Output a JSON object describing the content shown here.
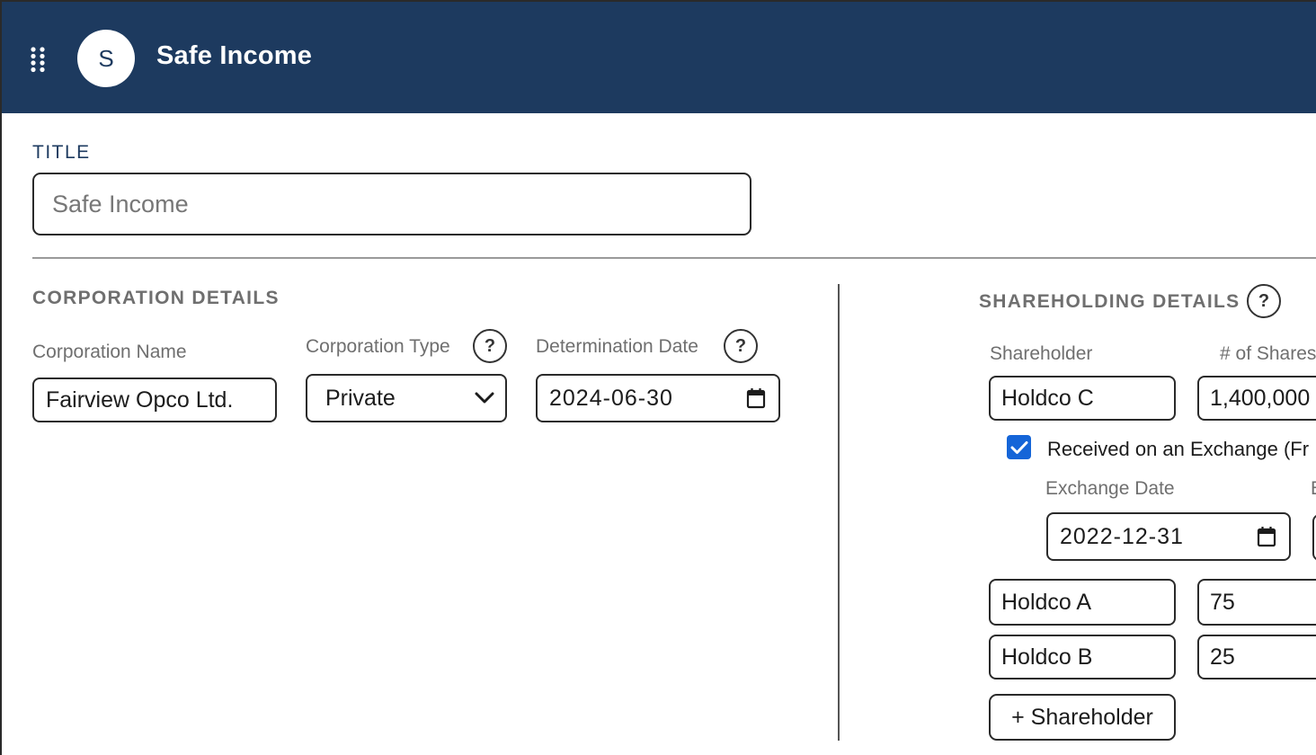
{
  "header": {
    "avatar_letter": "S",
    "app_title": "Safe Income",
    "header_bg": "#1d3a5f"
  },
  "title_section": {
    "label": "TITLE",
    "placeholder": "Safe Income"
  },
  "corporation": {
    "section_title": "CORPORATION DETAILS",
    "name_label": "Corporation Name",
    "name_value": "Fairview Opco Ltd.",
    "type_label": "Corporation Type",
    "type_value": "Private",
    "date_label": "Determination Date",
    "date_value": "2024-06-30"
  },
  "shareholding": {
    "section_title": "SHAREHOLDING DETAILS",
    "col_shareholder": "Shareholder",
    "col_shares": "# of Shares",
    "rows": [
      {
        "shareholder": "Holdco C",
        "shares": "1,400,000"
      },
      {
        "shareholder": "Holdco A",
        "shares": "75"
      },
      {
        "shareholder": "Holdco B",
        "shares": "25"
      }
    ],
    "exchange_checkbox_label": "Received on an Exchange (Fr",
    "exchange_checked": true,
    "exchange_date_label": "Exchange Date",
    "exchange_date_value": "2022-12-31",
    "exchange_col2_label_fragment": "E",
    "add_button_label": "+ Shareholder"
  },
  "icons": {
    "menu": "grid-dots-icon",
    "help": "question-icon",
    "dropdown": "chevron-down-icon",
    "calendar": "calendar-icon",
    "check": "check-icon"
  },
  "colors": {
    "accent": "#1565d8",
    "label_gray": "#6f6f6f"
  }
}
